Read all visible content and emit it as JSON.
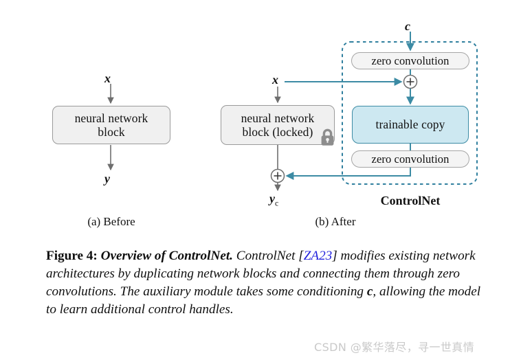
{
  "figure": {
    "panel_a": {
      "caption": "(a) Before",
      "input_label": "x",
      "output_label": "y",
      "block_label": "neural network block",
      "block_line1": "neural network",
      "block_line2": "block"
    },
    "panel_b": {
      "caption": "(b) After",
      "input_label": "x",
      "condition_label": "c",
      "output_label": "y",
      "output_subscript": "c",
      "locked_block_line1": "neural network",
      "locked_block_line2": "block (locked)",
      "lock_icon": "lock-icon",
      "controlnet_label": "ControlNet",
      "zero_conv_top": "zero convolution",
      "zero_conv_bottom": "zero convolution",
      "trainable_copy": "trainable copy",
      "add_node_symbol": "+"
    }
  },
  "caption": {
    "figure_number": "Figure 4:",
    "figure_title": "Overview of ControlNet.",
    "body_part1": "ControlNet ",
    "citation_open": "[",
    "citation": "ZA23",
    "citation_close": "]",
    "body_part2": " modifies existing network architectures by duplicating network blocks and connecting them through zero convolutions. The auxiliary module takes some conditioning ",
    "body_c": "c",
    "body_part3": ", allowing the model to learn additional control handles."
  },
  "watermark": {
    "text": "CSDN @繁华落尽，寻一世真情"
  },
  "colors": {
    "teal": "#3c8ba4",
    "gray_arrow": "#6e6e6e",
    "box_fill": "#f0f0f0",
    "box_border": "#9a9a9a",
    "blue_fill": "#cde8f1",
    "citation_blue": "#2222dd",
    "watermark_gray": "#c9c9c9"
  }
}
